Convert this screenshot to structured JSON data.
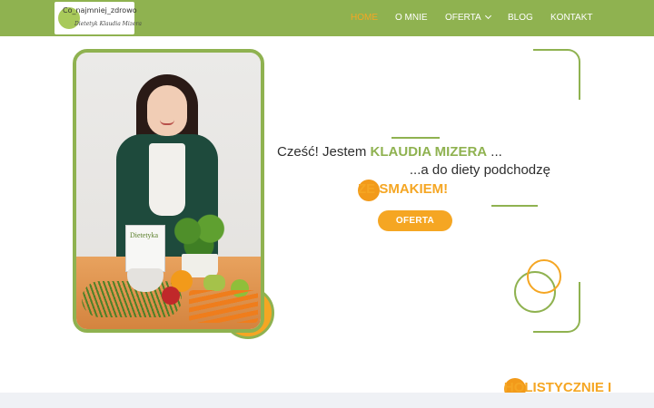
{
  "header": {
    "logo_title": "Co_najmniej_zdrowo",
    "logo_subtitle": "Dietetyk Klaudia Mizera",
    "nav": [
      {
        "label": "HOME",
        "active": true
      },
      {
        "label": "O MNIE",
        "active": false
      },
      {
        "label": "OFERTA",
        "active": false,
        "has_dropdown": true
      },
      {
        "label": "BLOG",
        "active": false
      },
      {
        "label": "KONTAKT",
        "active": false
      }
    ]
  },
  "hero": {
    "line1_prefix": "Cześć! Jestem ",
    "line1_name": "KLAUDIA MIZERA",
    "line1_suffix": " ...",
    "line2_prefix": "...a do diety podchodzę ",
    "line2_highlight": "HOLISTYCZNIE I",
    "line3_highlight": "ZE SMAKIEM!",
    "cta_label": "OFERTA"
  },
  "photo": {
    "book_title": "Dietetyka"
  },
  "colors": {
    "brand_green": "#8fb250",
    "accent_orange": "#f5a623",
    "text_dark": "#2e2e2e"
  }
}
